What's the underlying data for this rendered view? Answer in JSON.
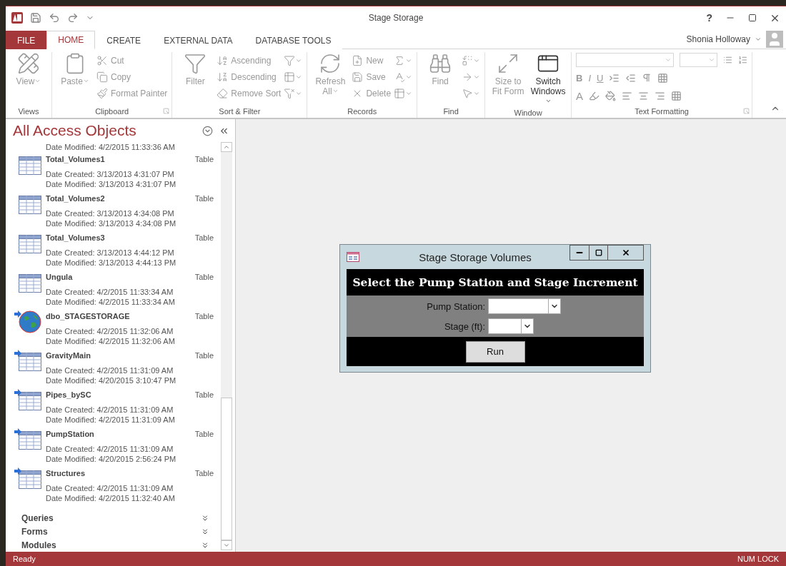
{
  "title_bar": {
    "title": "Stage Storage",
    "help": "?"
  },
  "tabs": [
    {
      "label": "FILE",
      "kind": "file",
      "selected": false
    },
    {
      "label": "HOME",
      "kind": "tab",
      "selected": true
    },
    {
      "label": "CREATE",
      "kind": "tab",
      "selected": false
    },
    {
      "label": "EXTERNAL DATA",
      "kind": "tab",
      "selected": false
    },
    {
      "label": "DATABASE TOOLS",
      "kind": "tab",
      "selected": false
    }
  ],
  "user": {
    "name": "Shonia Holloway"
  },
  "ribbon": {
    "groups": [
      {
        "label": "Views",
        "kind": "buttons",
        "launcher": false,
        "large": [
          {
            "label": "View",
            "disabled": true,
            "dropdown": true
          }
        ]
      },
      {
        "label": "Clipboard",
        "kind": "buttons",
        "launcher": true,
        "large": [
          {
            "label": "Paste",
            "disabled": true,
            "dropdown": true
          }
        ],
        "small": [
          {
            "label": "Cut",
            "disabled": true
          },
          {
            "label": "Copy",
            "disabled": true
          },
          {
            "label": "Format Painter",
            "disabled": true
          }
        ]
      },
      {
        "label": "Sort & Filter",
        "kind": "buttons",
        "launcher": false,
        "large": [
          {
            "label": "Filter",
            "disabled": true,
            "dropdown": false
          }
        ],
        "small": [
          {
            "label": "Ascending",
            "disabled": true
          },
          {
            "label": "Descending",
            "disabled": true
          },
          {
            "label": "Remove Sort",
            "disabled": true
          }
        ],
        "icon_buttons": [
          {
            "disabled": true
          },
          {
            "disabled": true
          },
          {
            "disabled": true
          }
        ]
      },
      {
        "label": "Records",
        "kind": "buttons",
        "launcher": false,
        "large": [
          {
            "label": "Refresh All",
            "disabled": true,
            "dropdown": true
          }
        ],
        "small": [
          {
            "label": "New",
            "disabled": true
          },
          {
            "label": "Save",
            "disabled": true
          },
          {
            "label": "Delete",
            "disabled": true
          }
        ],
        "icon_buttons": [
          {
            "disabled": true
          },
          {
            "disabled": true
          },
          {
            "disabled": true
          }
        ]
      },
      {
        "label": "Find",
        "kind": "buttons",
        "launcher": false,
        "large": [
          {
            "label": "Find",
            "disabled": true,
            "dropdown": false
          }
        ],
        "icon_buttons": [
          {
            "disabled": true
          },
          {
            "disabled": true
          },
          {
            "disabled": true
          }
        ]
      },
      {
        "label": "Window",
        "kind": "buttons",
        "launcher": false,
        "large": [
          {
            "label": "Size to Fit Form",
            "disabled": true,
            "dropdown": false
          },
          {
            "label": "Switch Windows",
            "disabled": false,
            "dropdown": true
          }
        ]
      },
      {
        "label": "Text Formatting",
        "kind": "formatting",
        "launcher": true,
        "letters": [
          "B",
          "I",
          "U"
        ],
        "font_color": "A"
      }
    ]
  },
  "nav_pane": {
    "title": "All Access Objects",
    "partial_item": {
      "modified": "Date Modified: 4/2/2015 11:33:36 AM"
    },
    "items": [
      {
        "name": "Total_Volumes1",
        "type": "Table",
        "kind": "table",
        "linked": false,
        "created": "Date Created: 3/13/2013 4:31:07 PM",
        "modified": "Date Modified: 3/13/2013 4:31:07 PM"
      },
      {
        "name": "Total_Volumes2",
        "type": "Table",
        "kind": "table",
        "linked": false,
        "created": "Date Created: 3/13/2013 4:34:08 PM",
        "modified": "Date Modified: 3/13/2013 4:34:08 PM"
      },
      {
        "name": "Total_Volumes3",
        "type": "Table",
        "kind": "table",
        "linked": false,
        "created": "Date Created: 3/13/2013 4:44:12 PM",
        "modified": "Date Modified: 3/13/2013 4:44:13 PM"
      },
      {
        "name": "Ungula",
        "type": "Table",
        "kind": "table",
        "linked": false,
        "created": "Date Created: 4/2/2015 11:33:34 AM",
        "modified": "Date Modified: 4/2/2015 11:33:34 AM"
      },
      {
        "name": "dbo_STAGESTORAGE",
        "type": "Table",
        "kind": "globe",
        "linked": true,
        "created": "Date Created: 4/2/2015 11:32:06 AM",
        "modified": "Date Modified: 4/2/2015 11:32:06 AM"
      },
      {
        "name": "GravityMain",
        "type": "Table",
        "kind": "table",
        "linked": true,
        "created": "Date Created: 4/2/2015 11:31:09 AM",
        "modified": "Date Modified: 4/20/2015 3:10:47 PM"
      },
      {
        "name": "Pipes_bySC",
        "type": "Table",
        "kind": "table",
        "linked": true,
        "created": "Date Created: 4/2/2015 11:31:09 AM",
        "modified": "Date Modified: 4/2/2015 11:31:09 AM"
      },
      {
        "name": "PumpStation",
        "type": "Table",
        "kind": "table",
        "linked": true,
        "created": "Date Created: 4/2/2015 11:31:09 AM",
        "modified": "Date Modified: 4/20/2015 2:56:24 PM"
      },
      {
        "name": "Structures",
        "type": "Table",
        "kind": "table",
        "linked": true,
        "created": "Date Created: 4/2/2015 11:31:09 AM",
        "modified": "Date Modified: 4/2/2015 11:32:40 AM"
      }
    ],
    "groups": [
      {
        "label": "Queries",
        "expanded": false
      },
      {
        "label": "Forms",
        "expanded": false
      },
      {
        "label": "Modules",
        "expanded": false
      }
    ]
  },
  "dialog": {
    "title": "Stage Storage Volumes",
    "heading": "Select the Pump Station and Stage Increment",
    "fields": [
      {
        "label": "Pump Station:",
        "kind": "wide"
      },
      {
        "label": "Stage (ft):",
        "kind": "narrow"
      }
    ],
    "button": "Run"
  },
  "status_bar": {
    "left": "Ready",
    "right": "NUM LOCK"
  }
}
